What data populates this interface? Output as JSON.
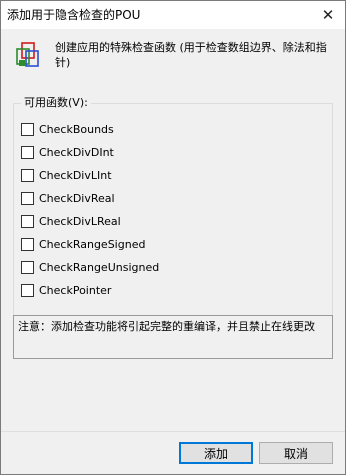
{
  "window": {
    "title": "添加用于隐含检查的POU"
  },
  "header": {
    "icon": "pou-checks-icon",
    "description": "创建应用的特殊检查函数 (用于检查数组边界、除法和指针)"
  },
  "group": {
    "legend": "可用函数(V):",
    "items": [
      {
        "label": "CheckBounds",
        "checked": false
      },
      {
        "label": "CheckDivDInt",
        "checked": false
      },
      {
        "label": "CheckDivLInt",
        "checked": false
      },
      {
        "label": "CheckDivReal",
        "checked": false
      },
      {
        "label": "CheckDivLReal",
        "checked": false
      },
      {
        "label": "CheckRangeSigned",
        "checked": false
      },
      {
        "label": "CheckRangeUnsigned",
        "checked": false
      },
      {
        "label": "CheckPointer",
        "checked": false
      }
    ]
  },
  "note": {
    "text": "注意：添加检查功能将引起完整的重编译，并且禁止在线更改"
  },
  "buttons": {
    "add": "添加",
    "cancel": "取消"
  },
  "colors": {
    "accent": "#0078d7",
    "icon_red": "#d11b1b",
    "icon_green": "#2e8b2e",
    "icon_blue": "#2b4ed6"
  }
}
